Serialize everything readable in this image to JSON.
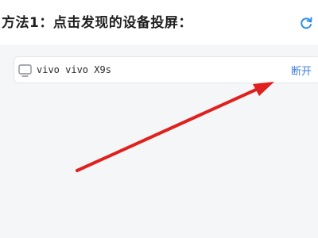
{
  "header": {
    "title": "方法1：点击发现的设备投屏：",
    "refresh_icon": "refresh-icon"
  },
  "device_list": [
    {
      "icon": "monitor-icon",
      "name": "vivo vivo X9s",
      "action_label": "断开"
    }
  ],
  "colors": {
    "accent": "#3b7ddd",
    "annotation_arrow": "#e0201c",
    "background": "#f5f6f8"
  }
}
